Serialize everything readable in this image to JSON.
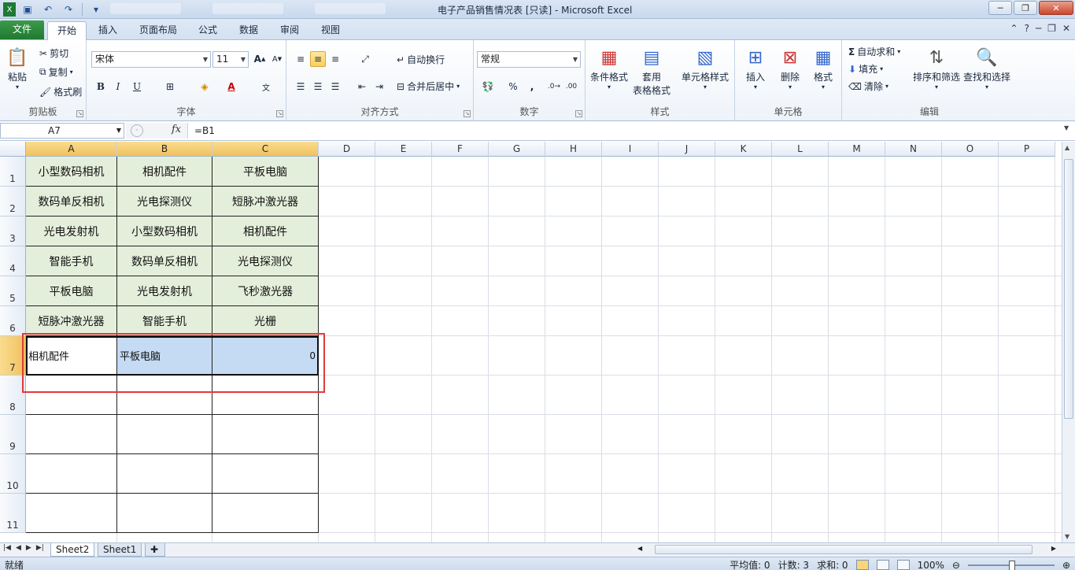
{
  "window": {
    "title": "电子产品销售情况表  [只读]  -  Microsoft Excel"
  },
  "ribbon_tabs": [
    {
      "label": "文件"
    },
    {
      "label": "开始"
    },
    {
      "label": "插入"
    },
    {
      "label": "页面布局"
    },
    {
      "label": "公式"
    },
    {
      "label": "数据"
    },
    {
      "label": "审阅"
    },
    {
      "label": "视图"
    }
  ],
  "clipboard": {
    "paste": "粘贴",
    "cut": "剪切",
    "copy": "复制",
    "format_painter": "格式刷",
    "group": "剪贴板"
  },
  "font": {
    "name": "宋体",
    "size": "11",
    "group": "字体"
  },
  "alignment": {
    "wrap": "自动换行",
    "merge": "合并后居中",
    "group": "对齐方式"
  },
  "number": {
    "format": "常规",
    "group": "数字"
  },
  "styles": {
    "conditional": "条件格式",
    "table_line1": "套用",
    "table_line2": "表格格式",
    "cell_styles": "单元格样式",
    "group": "样式"
  },
  "cells": {
    "insert": "插入",
    "delete": "删除",
    "format": "格式",
    "group": "单元格"
  },
  "editing": {
    "autosum": "自动求和",
    "fill": "填充",
    "clear": "清除",
    "sort": "排序和筛选",
    "find": "查找和选择",
    "group": "编辑"
  },
  "formula_bar": {
    "name_box": "A7",
    "fx": "fx",
    "formula": "=B1"
  },
  "columns": [
    "A",
    "B",
    "C",
    "D",
    "E",
    "F",
    "G",
    "H",
    "I",
    "J",
    "K",
    "L",
    "M",
    "N",
    "O",
    "P"
  ],
  "rows": [
    "1",
    "2",
    "3",
    "4",
    "5",
    "6",
    "7",
    "8",
    "9",
    "10",
    "11"
  ],
  "grid": [
    [
      "小型数码相机",
      "相机配件",
      "平板电脑"
    ],
    [
      "数码单反相机",
      "光电探测仪",
      "短脉冲激光器"
    ],
    [
      "光电发射机",
      "小型数码相机",
      "相机配件"
    ],
    [
      "智能手机",
      "数码单反相机",
      "光电探测仪"
    ],
    [
      "平板电脑",
      "光电发射机",
      "飞秒激光器"
    ],
    [
      "短脉冲激光器",
      "智能手机",
      "光栅"
    ],
    [
      "相机配件",
      "平板电脑",
      "0"
    ]
  ],
  "sheets": [
    {
      "label": "Sheet2"
    },
    {
      "label": "Sheet1"
    }
  ],
  "status": {
    "ready": "就绪",
    "average": "平均值: 0",
    "count": "计数: 3",
    "sum": "求和: 0",
    "zoom": "100%"
  }
}
